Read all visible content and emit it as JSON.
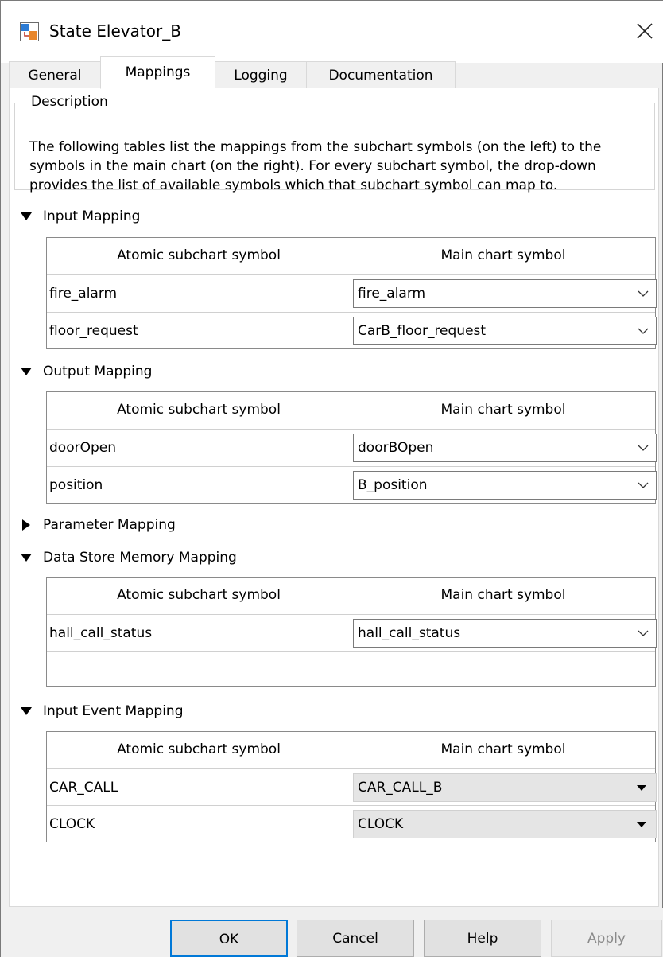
{
  "window": {
    "title": "State Elevator_B"
  },
  "tabs": [
    {
      "label": "General"
    },
    {
      "label": "Mappings"
    },
    {
      "label": "Logging"
    },
    {
      "label": "Documentation"
    }
  ],
  "description": {
    "legend": "Description",
    "lines": [
      "The following tables list the mappings from the subchart symbols (on the left) to the",
      "symbols in the main chart (on the right). For every subchart symbol, the drop-down",
      "provides the list of available symbols which that subchart symbol can map to."
    ]
  },
  "table_headers": {
    "left": "Atomic subchart symbol",
    "right": "Main chart symbol"
  },
  "sections": {
    "input": {
      "title": "Input Mapping",
      "expanded": true,
      "rows": [
        {
          "subchart": "fire_alarm",
          "main": "fire_alarm"
        },
        {
          "subchart": "floor_request",
          "main": "CarB_floor_request"
        }
      ]
    },
    "output": {
      "title": "Output Mapping",
      "expanded": true,
      "rows": [
        {
          "subchart": "doorOpen",
          "main": "doorBOpen"
        },
        {
          "subchart": "position",
          "main": "B_position"
        }
      ]
    },
    "parameter": {
      "title": "Parameter Mapping",
      "expanded": false
    },
    "dsm": {
      "title": "Data Store Memory Mapping",
      "expanded": true,
      "rows": [
        {
          "subchart": "hall_call_status",
          "main": "hall_call_status"
        }
      ]
    },
    "event": {
      "title": "Input Event Mapping",
      "expanded": true,
      "rows": [
        {
          "subchart": "CAR_CALL",
          "main": "CAR_CALL_B"
        },
        {
          "subchart": "CLOCK",
          "main": "CLOCK"
        }
      ]
    }
  },
  "buttons": {
    "ok": "OK",
    "cancel": "Cancel",
    "help": "Help",
    "apply": "Apply"
  },
  "colors": {
    "accent": "#0078d7",
    "readonly_dropdown": "#e5e5e5"
  }
}
